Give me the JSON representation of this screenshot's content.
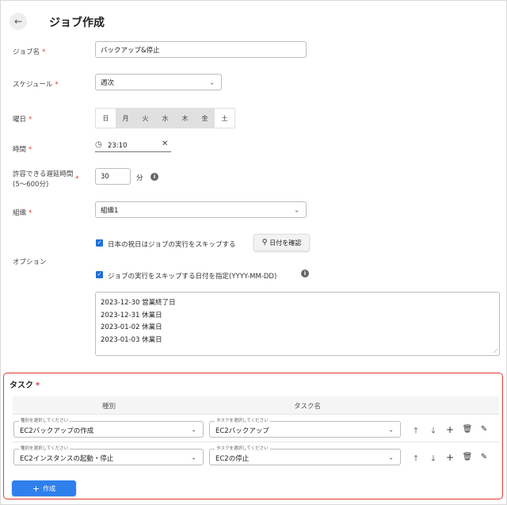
{
  "header": {
    "title": "ジョブ作成",
    "back_icon": "←"
  },
  "form": {
    "job_name": {
      "label": "ジョブ名",
      "value": "バックアップ&停止"
    },
    "schedule": {
      "label": "スケジュール",
      "value": "週次"
    },
    "weekday": {
      "label": "曜日",
      "days": [
        {
          "label": "日",
          "selected": false
        },
        {
          "label": "月",
          "selected": true
        },
        {
          "label": "火",
          "selected": true
        },
        {
          "label": "水",
          "selected": true
        },
        {
          "label": "木",
          "selected": true
        },
        {
          "label": "金",
          "selected": true
        },
        {
          "label": "土",
          "selected": false
        }
      ]
    },
    "time": {
      "label": "時間",
      "value": "23:10",
      "clear_icon": "✕"
    },
    "delay": {
      "label_line1": "許容できる遅延時間",
      "label_line2": "(5〜600分)",
      "value": "30",
      "unit": "分",
      "info": "i"
    },
    "org": {
      "label": "組織",
      "value": "組織1"
    },
    "options": {
      "label": "オプション",
      "skip_holidays": "日本の祝日はジョブの実行をスキップする",
      "check_dates_button": "日付を確認",
      "skip_dates": "ジョブの実行をスキップする日付を指定(YYYY-MM-DD)",
      "info": "i",
      "dates": [
        "2023-12-30 営業終了日",
        "2023-12-31 休業日",
        "2023-01-02 休業日",
        "2023-01-03 休業日"
      ]
    },
    "required_mark": "*"
  },
  "tasks": {
    "title": "タスク",
    "col_type": "種別",
    "col_name": "タスク名",
    "type_legend": "種別を選択してください",
    "name_legend": "タスクを選択してください",
    "rows": [
      {
        "type": "EC2バックアップの作成",
        "name": "EC2バックアップ"
      },
      {
        "type": "EC2インスタンスの起動・停止",
        "name": "EC2の停止"
      }
    ]
  },
  "create_button": {
    "plus": "+",
    "label": "作成"
  },
  "colors": {
    "accent": "#2f80ed",
    "required": "#e53935",
    "checkbox": "#1e6fd9"
  }
}
